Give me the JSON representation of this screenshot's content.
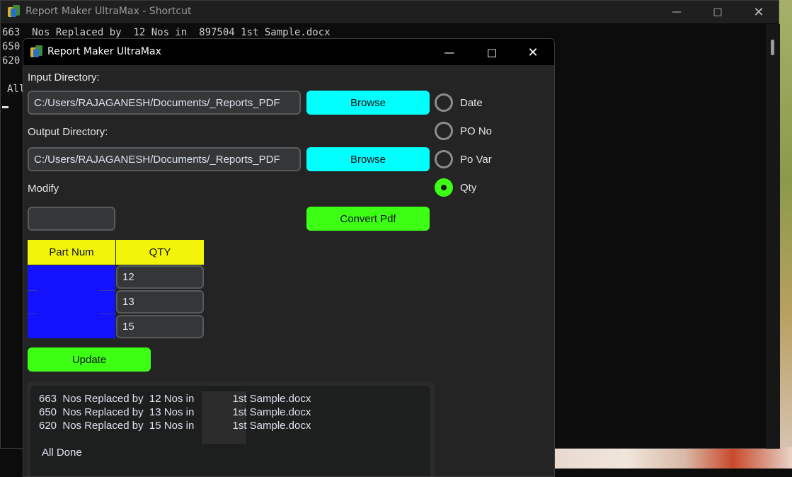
{
  "console": {
    "title": "Report Maker UltraMax - Shortcut",
    "line1": "663  Nos Replaced by  12 Nos in  897504 1st Sample.docx",
    "line2": "650",
    "line3": "620",
    "line4": "All"
  },
  "app": {
    "title": "Report Maker UltraMax",
    "input_label": "Input Directory:",
    "input_value": "C:/Users/RAJAGANESH/Documents/_Reports_PDF",
    "output_label": "Output Directory:",
    "output_value": "C:/Users/RAJAGANESH/Documents/_Reports_PDF",
    "browse_label": "Browse",
    "modify_label": "Modify",
    "modify_value": "",
    "convert_label": "Convert Pdf",
    "update_label": "Update",
    "radios": [
      {
        "label": "Date",
        "selected": false
      },
      {
        "label": "PO No",
        "selected": false
      },
      {
        "label": "Po Var",
        "selected": false
      },
      {
        "label": "Qty",
        "selected": true
      }
    ],
    "table": {
      "headers": [
        "Part Num",
        "QTY"
      ],
      "qty_values": [
        "12",
        "13",
        "15"
      ]
    },
    "log": {
      "lines": [
        "663  Nos Replaced by  12 Nos in             1st Sample.docx",
        "650  Nos Replaced by  13 Nos in             1st Sample.docx",
        "620  Nos Replaced by  15 Nos in             1st Sample.docx"
      ],
      "done": "All Done"
    }
  },
  "colors": {
    "cyan_button": "#00ffff",
    "green_button": "#3cff14",
    "table_header": "#f2f40a",
    "part_num_cell": "#1212ff"
  }
}
